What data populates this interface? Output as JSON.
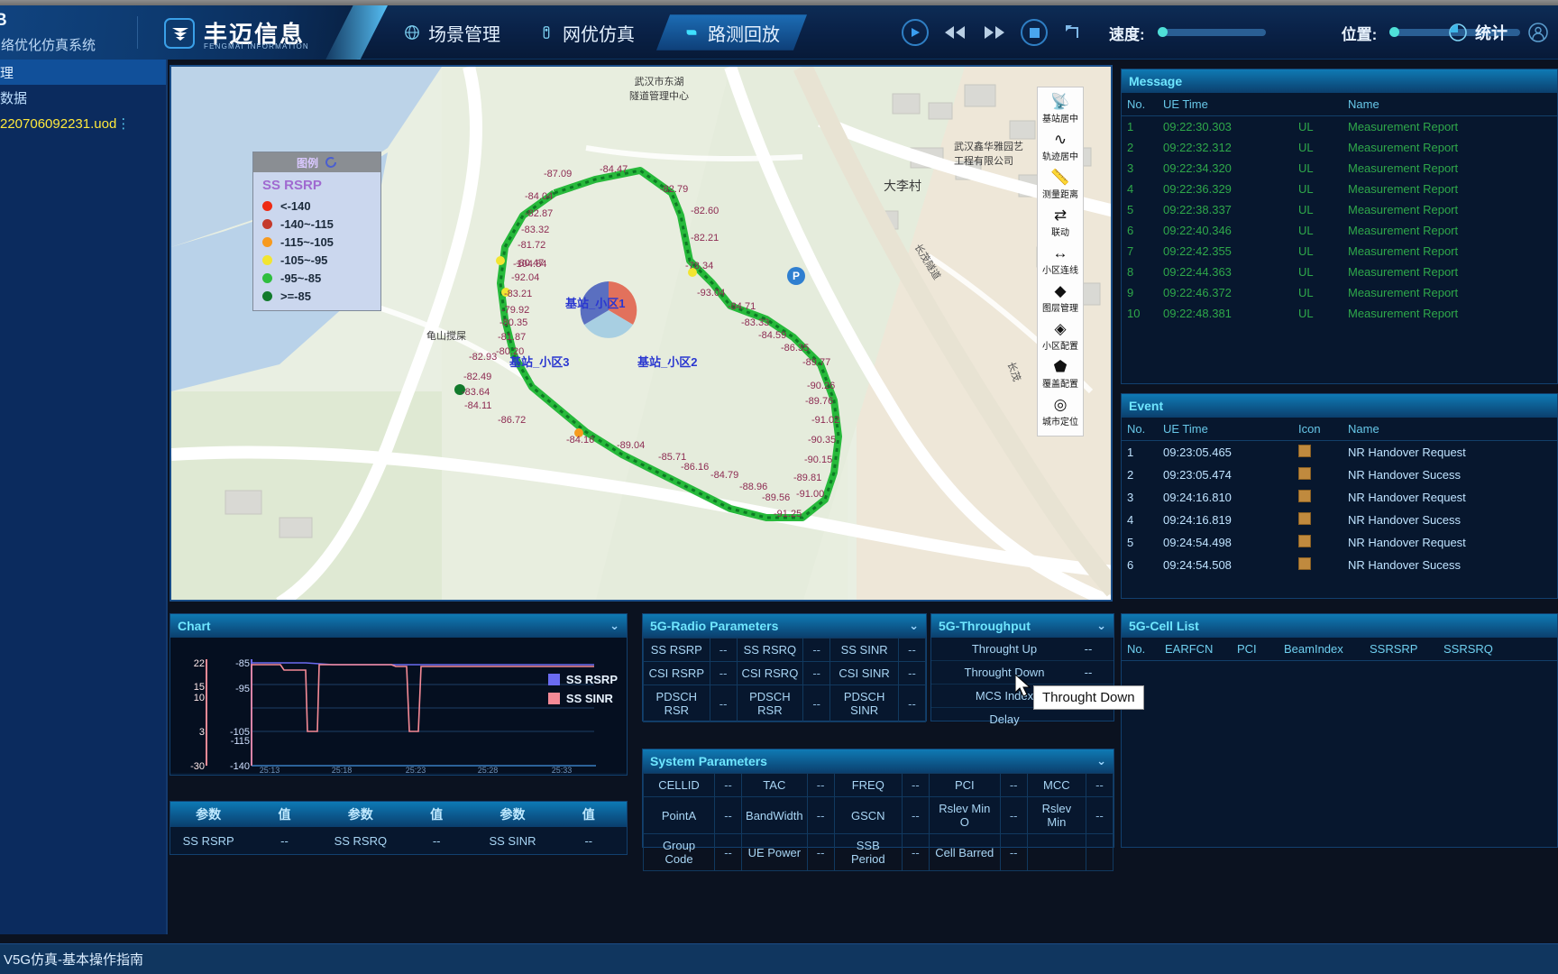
{
  "header": {
    "system_name": "B",
    "system_subtitle": "网络优化仿真系统",
    "brand_cn": "丰迈信息",
    "brand_en": "FENGMAI INFORMATION",
    "nav": [
      {
        "label": "场景管理",
        "icon": "globe-icon",
        "active": false
      },
      {
        "label": "网优仿真",
        "icon": "tower-icon",
        "active": false
      },
      {
        "label": "路测回放",
        "icon": "play-marker-icon",
        "active": true
      }
    ],
    "transport": {
      "play": "play-icon",
      "rewind": "rewind-icon",
      "forward": "fast-forward-icon",
      "stop": "stop-icon",
      "loop": "loop-icon"
    },
    "speed_label": "速度:",
    "position_label": "位置:",
    "stats_label": "统计",
    "account_icon": "user-account-icon"
  },
  "sidebar": {
    "group_label": "理",
    "sub_label": "数据",
    "file_name": "220706092231.uod",
    "file_menu_icon": "kebab-menu-icon"
  },
  "statusbar": {
    "text": "V5G仿真-基本操作指南"
  },
  "legend": {
    "title": "图例",
    "metric": "SS RSRP",
    "items": [
      {
        "label": "<-140",
        "color": "#ee2b14"
      },
      {
        "label": "-140~-115",
        "color": "#c43a2c"
      },
      {
        "label": "-115~-105",
        "color": "#f79a1e"
      },
      {
        "label": "-105~-95",
        "color": "#f2e531"
      },
      {
        "label": "-95~-85",
        "color": "#2fbe3f"
      },
      {
        "label": ">=-85",
        "color": "#127a2c"
      }
    ]
  },
  "map_tools": [
    {
      "label": "基站居中",
      "icon": "antenna-icon"
    },
    {
      "label": "轨迹居中",
      "icon": "track-icon"
    },
    {
      "label": "测量距离",
      "icon": "ruler-icon"
    },
    {
      "label": "联动",
      "icon": "sync-icon"
    },
    {
      "label": "小区连线",
      "icon": "link-icon"
    },
    {
      "label": "图层管理",
      "icon": "layers-icon"
    },
    {
      "label": "小区配置",
      "icon": "layers2-icon"
    },
    {
      "label": "覆盖配置",
      "icon": "coverage-icon"
    },
    {
      "label": "城市定位",
      "icon": "target-icon"
    }
  ],
  "map": {
    "cell_labels": [
      "基站_小区1",
      "基站_小区2",
      "基站_小区3"
    ],
    "pois": [
      "武汉市东湖\n隧道管理中心",
      "武汉鑫华雅园艺\n工程有限公司",
      "大李村",
      "龟山搅屎",
      "长茂隧道",
      "长茂"
    ],
    "rsrp_labels": [
      "-87.09",
      "-84.47",
      "-82.79",
      "-84.04",
      "-82.87",
      "-83.32",
      "-82.60",
      "-81.72",
      "-80.47",
      "-82.21",
      "-104.84",
      "-92.04",
      "-78.34",
      "-83.21",
      "-79.92",
      "-93.04",
      "-80.35",
      "-81.87",
      "-84.71",
      "-80.20",
      "-83.33",
      "-82.93",
      "-84.59",
      "-82.49",
      "-86.35",
      "-83.64",
      "-89.77",
      "-84.11",
      "-90.26",
      "-86.72",
      "-89.76",
      "-84.16",
      "-91.02",
      "-89.04",
      "-90.35",
      "-85.71",
      "-90.15",
      "-86.16",
      "-84.79",
      "-89.81",
      "-88.96",
      "-91.00",
      "-89.56",
      "-91.25"
    ]
  },
  "message_panel": {
    "title": "Message",
    "columns": [
      "No.",
      "UE Time",
      "",
      "Name"
    ],
    "rows": [
      [
        "1",
        "09:22:30.303",
        "UL",
        "Measurement Report"
      ],
      [
        "2",
        "09:22:32.312",
        "UL",
        "Measurement Report"
      ],
      [
        "3",
        "09:22:34.320",
        "UL",
        "Measurement Report"
      ],
      [
        "4",
        "09:22:36.329",
        "UL",
        "Measurement Report"
      ],
      [
        "5",
        "09:22:38.337",
        "UL",
        "Measurement Report"
      ],
      [
        "6",
        "09:22:40.346",
        "UL",
        "Measurement Report"
      ],
      [
        "7",
        "09:22:42.355",
        "UL",
        "Measurement Report"
      ],
      [
        "8",
        "09:22:44.363",
        "UL",
        "Measurement Report"
      ],
      [
        "9",
        "09:22:46.372",
        "UL",
        "Measurement Report"
      ],
      [
        "10",
        "09:22:48.381",
        "UL",
        "Measurement Report"
      ]
    ]
  },
  "event_panel": {
    "title": "Event",
    "columns": [
      "No.",
      "UE Time",
      "Icon",
      "Name"
    ],
    "rows": [
      [
        "1",
        "09:23:05.465",
        "handover-icon",
        "NR Handover Request"
      ],
      [
        "2",
        "09:23:05.474",
        "handover-icon",
        "NR Handover Sucess"
      ],
      [
        "3",
        "09:24:16.810",
        "handover-icon",
        "NR Handover Request"
      ],
      [
        "4",
        "09:24:16.819",
        "handover-icon",
        "NR Handover Sucess"
      ],
      [
        "5",
        "09:24:54.498",
        "handover-icon",
        "NR Handover Request"
      ],
      [
        "6",
        "09:24:54.508",
        "handover-icon",
        "NR Handover Sucess"
      ]
    ]
  },
  "cell_list_panel": {
    "title": "5G-Cell List",
    "columns": [
      "No.",
      "EARFCN",
      "PCI",
      "BeamIndex",
      "SSRSRP",
      "SSRSRQ"
    ]
  },
  "chart_panel": {
    "title": "Chart",
    "collapse_icon": "chevron-down-icon"
  },
  "chart_data": {
    "type": "line",
    "title": "Chart",
    "xlabel": "",
    "ylabel": "",
    "legend": [
      {
        "name": "SS RSRP",
        "color": "#6b6bf0"
      },
      {
        "name": "SS SINR",
        "color": "#f58a96"
      }
    ],
    "left_axis": {
      "label": "SS SINR",
      "ticks": [
        22,
        15,
        10,
        3,
        -30
      ],
      "ylim": [
        -30,
        22
      ]
    },
    "right_axis": {
      "label": "SS RSRP",
      "ticks": [
        -85,
        -95,
        -105,
        -115,
        -140
      ],
      "ylim": [
        -140,
        -85
      ]
    },
    "x_ticks": [
      "25:13",
      "25:18",
      "25:23",
      "25:28",
      "25:33"
    ],
    "series": [
      {
        "name": "SS RSRP",
        "color": "#6b6bf0",
        "values": [
          -140,
          -86,
          -86,
          -86,
          -86,
          -86,
          -86,
          -86,
          -86,
          -86,
          -86,
          -86,
          -86,
          -86,
          -86,
          -86,
          -86,
          -86,
          -86,
          -86
        ]
      },
      {
        "name": "SS SINR",
        "color": "#f58a96",
        "values": [
          -30,
          21,
          21,
          20,
          20,
          19,
          3,
          3,
          19,
          19,
          19,
          19,
          19,
          19,
          3,
          3,
          19,
          19,
          19,
          19
        ]
      }
    ],
    "grid": true,
    "legend_position": "right"
  },
  "param_table": {
    "headers": [
      "参数",
      "值",
      "参数",
      "值",
      "参数",
      "值"
    ],
    "rows": [
      [
        "SS RSRP",
        "--",
        "SS RSRQ",
        "--",
        "SS SINR",
        "--"
      ]
    ]
  },
  "radio_panel": {
    "title": "5G-Radio Parameters",
    "collapse_icon": "chevron-down-icon",
    "rows": [
      [
        {
          "k": "SS RSRP",
          "v": "--"
        },
        {
          "k": "SS RSRQ",
          "v": "--"
        },
        {
          "k": "SS SINR",
          "v": "--"
        }
      ],
      [
        {
          "k": "CSI RSRP",
          "v": "--"
        },
        {
          "k": "CSI RSRQ",
          "v": "--"
        },
        {
          "k": "CSI SINR",
          "v": "--"
        }
      ],
      [
        {
          "k": "PDSCH RSR",
          "v": "--"
        },
        {
          "k": "PDSCH RSR",
          "v": "--"
        },
        {
          "k": "PDSCH SINR",
          "v": "--"
        }
      ]
    ]
  },
  "throughput_panel": {
    "title": "5G-Throughput",
    "collapse_icon": "chevron-down-icon",
    "rows": [
      {
        "k": "Throught Up",
        "v": "--"
      },
      {
        "k": "Throught Down",
        "v": "--"
      },
      {
        "k": "MCS Index",
        "v": "--"
      },
      {
        "k": "Delay",
        "v": ""
      }
    ]
  },
  "system_panel": {
    "title": "System Parameters",
    "collapse_icon": "chevron-down-icon",
    "rows": [
      [
        {
          "k": "CELLID",
          "v": "--"
        },
        {
          "k": "TAC",
          "v": "--"
        },
        {
          "k": "FREQ",
          "v": "--"
        },
        {
          "k": "PCI",
          "v": "--"
        },
        {
          "k": "MCC",
          "v": "--"
        }
      ],
      [
        {
          "k": "PointA",
          "v": "--"
        },
        {
          "k": "BandWidth",
          "v": "--"
        },
        {
          "k": "GSCN",
          "v": "--"
        },
        {
          "k": "Rslev Min O",
          "v": "--"
        },
        {
          "k": "Rslev Min",
          "v": "--"
        }
      ],
      [
        {
          "k": "Group Code",
          "v": "--"
        },
        {
          "k": "UE Power",
          "v": "--"
        },
        {
          "k": "SSB Period",
          "v": "--"
        },
        {
          "k": "Cell Barred",
          "v": "--"
        },
        {
          "k": "",
          "v": ""
        }
      ]
    ]
  },
  "tooltip": {
    "text": "Throught Down"
  }
}
